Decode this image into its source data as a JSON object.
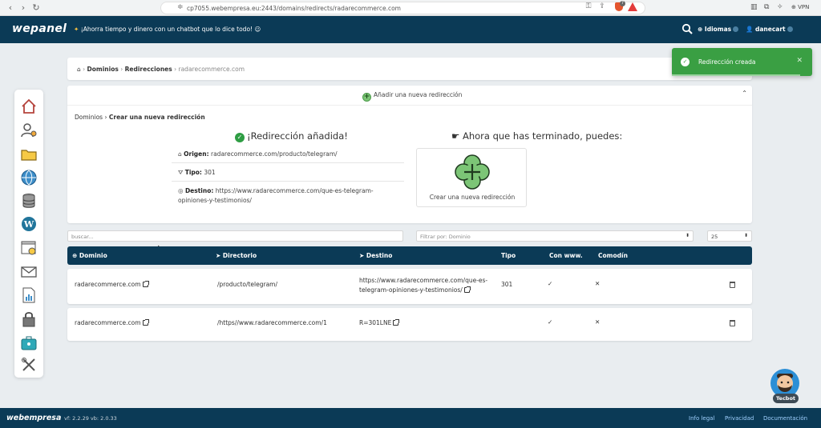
{
  "browser": {
    "url": "cp7055.webempresa.eu:2443/domains/redirects/radarecommerce.com",
    "shield_badge": "7",
    "vpn": "VPN"
  },
  "topnav": {
    "logo": "wepanel",
    "promo": "¡Ahorra tiempo y dinero con un chatbot que lo dice todo!",
    "languages": "Idiomas",
    "user": "danecart"
  },
  "sidebar": {
    "items": [
      "home-icon",
      "user-settings-icon",
      "folder-icon",
      "globe-icon",
      "database-icon",
      "wordpress-icon",
      "web-stats-icon",
      "mail-icon",
      "report-icon",
      "security-icon",
      "toolbox-icon",
      "tools-icon"
    ]
  },
  "breadcrumb": {
    "dominios": "Dominios",
    "redirecciones": "Redirecciones",
    "current": "radarecommerce.com"
  },
  "panel": {
    "add_label": "Añadir una nueva redirección",
    "sub_crumb_root": "Dominios",
    "sub_crumb_current": "Crear una nueva redirección",
    "success_title": "¡Redirección añadida!",
    "origin_label": "Origen:",
    "origin_value": "radarecommerce.com/producto/telegram/",
    "type_label": "Tipo:",
    "type_value": "301",
    "dest_label": "Destino:",
    "dest_value_1": "https://www.radarecommerce.com/que-es-telegram-",
    "dest_value_2": "opiniones-y-testimonios/",
    "next_title": "Ahora que has terminado, puedes:",
    "create_label": "Crear una nueva redirección"
  },
  "filters": {
    "search_placeholder": "buscar...",
    "filter_by": "Filtrar por: Dominio",
    "page_size": "25"
  },
  "table": {
    "headers": {
      "domain": "Dominio",
      "directory": "Directorio",
      "destination": "Destino",
      "type": "Tipo",
      "www": "Con www.",
      "wildcard": "Comodín"
    },
    "rows": [
      {
        "domain": "radarecommerce.com",
        "directory": "/producto/telegram/",
        "destination_1": "https://www.radarecommerce.com/que-es-",
        "destination_2": "telegram-opiniones-y-testimonios/",
        "type": "301",
        "www": "✓",
        "wildcard": "✕"
      },
      {
        "domain": "radarecommerce.com",
        "directory": "/https//www.radarecommerce.com/1",
        "destination_1": "R=301LNE",
        "destination_2": "",
        "type": "",
        "www": "✓",
        "wildcard": "✕"
      }
    ]
  },
  "toast": {
    "message": "Redirección creada",
    "color": "#3a9f43"
  },
  "tecbot": {
    "label": "Tecbot"
  },
  "footer": {
    "logo": "webempresa",
    "version": "vf: 2.2.29 vb: 2.0.33",
    "info_legal": "Info legal",
    "privacidad": "Privacidad",
    "documentacion": "Documentación"
  },
  "colors": {
    "nav_bg": "#0b3a56",
    "success": "#2e9d43",
    "accent_green": "#7cc576"
  }
}
